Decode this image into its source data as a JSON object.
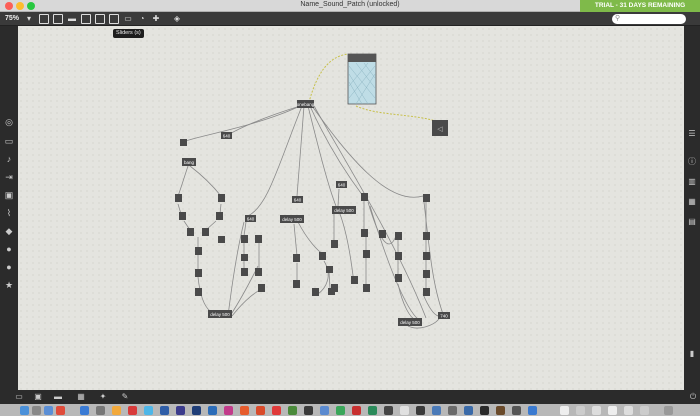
{
  "window": {
    "title": "Name_Sound_Patch (unlocked)",
    "trial_banner": "TRIAL - 31 DAYS REMAINING"
  },
  "toolbar": {
    "zoom": "75%",
    "tooltip": "Sliders  (s)"
  },
  "objects": {
    "onebang": "onebang",
    "n640": "640",
    "bang": "bang",
    "n640b": "640",
    "n640c": "640",
    "n640d": "640",
    "n740": "740",
    "delay_top_a": "delay 500",
    "delay_top_b": "delay 500",
    "delay_bottom_a": "delay 500",
    "delay_bottom_b": "delay 500"
  },
  "colors": {
    "canvas": "#e4e4df",
    "object": "#4a4a4a",
    "trial": "#7fba4a"
  }
}
